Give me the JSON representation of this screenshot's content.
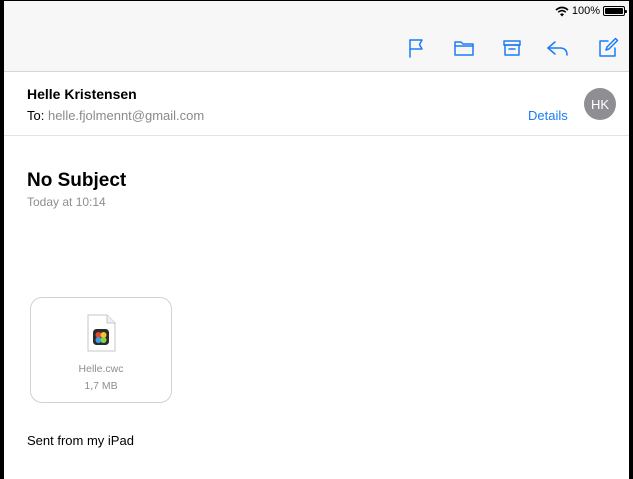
{
  "status_bar": {
    "battery_label": "100%",
    "battery_level": 1.0
  },
  "toolbar": {
    "icons": [
      "flag-icon",
      "folder-icon",
      "archive-icon",
      "reply-icon",
      "compose-icon"
    ],
    "accent_color": "#1a7cf5"
  },
  "message": {
    "sender_name": "Helle Kristensen",
    "to_label": "To:",
    "to_address": "helle.fjolmennt@gmail.com",
    "details_label": "Details",
    "avatar_initials": "HK",
    "subject": "No Subject",
    "date": "Today at 10:14",
    "attachment": {
      "file_name": "Helle.cwc",
      "file_size": "1,7 MB",
      "icon": "app-file-icon"
    },
    "signature": "Sent from my iPad"
  }
}
